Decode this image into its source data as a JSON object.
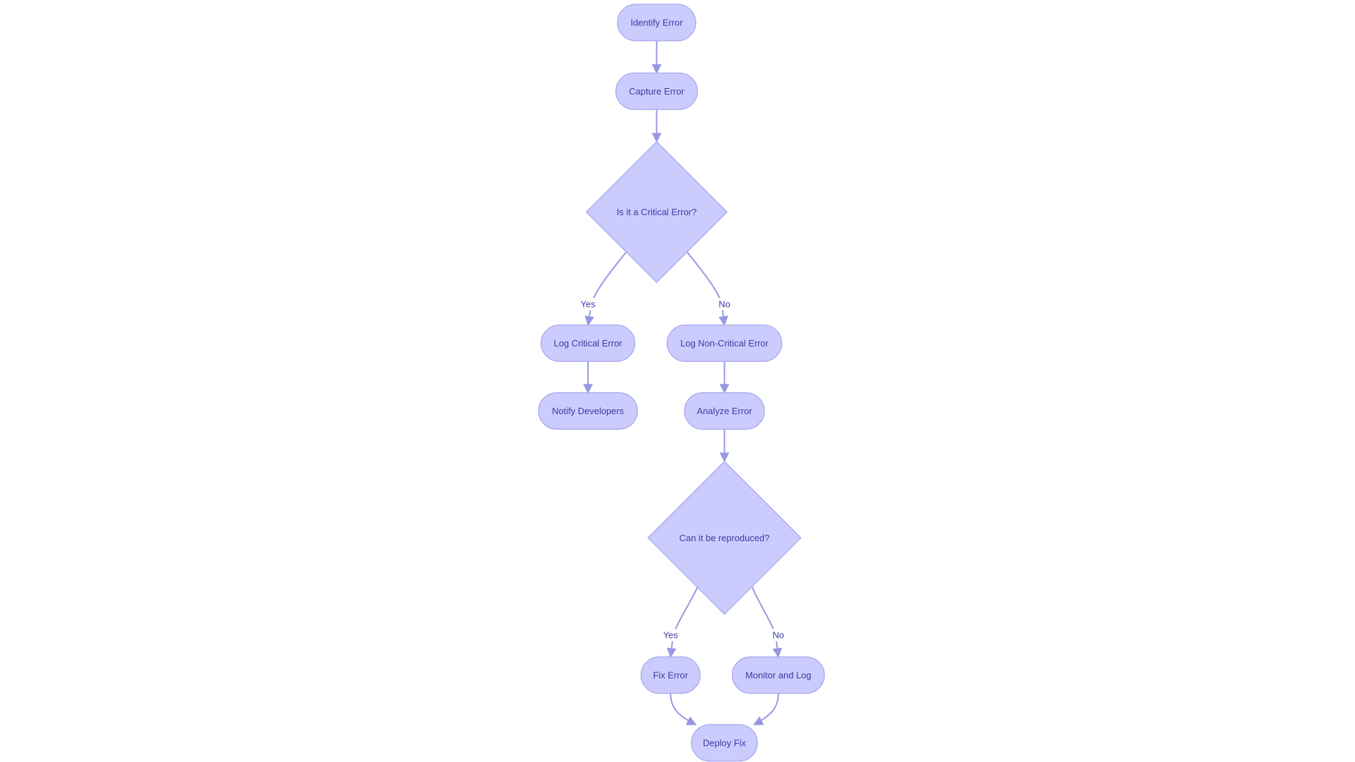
{
  "diagram": {
    "type": "flowchart",
    "direction": "top-down",
    "colors": {
      "node_fill": "#cbcbfd",
      "node_stroke": "#a6a6ef",
      "text": "#3b3ba6",
      "edge": "#9797e2",
      "background": "#ffffff"
    },
    "nodes": [
      {
        "id": "identify",
        "label": "Identify Error",
        "shape": "rounded"
      },
      {
        "id": "capture",
        "label": "Capture Error",
        "shape": "rounded"
      },
      {
        "id": "critical",
        "label": "Is it a Critical Error?",
        "shape": "diamond"
      },
      {
        "id": "logcrit",
        "label": "Log Critical Error",
        "shape": "rounded"
      },
      {
        "id": "lognon",
        "label": "Log Non-Critical Error",
        "shape": "rounded"
      },
      {
        "id": "notify",
        "label": "Notify Developers",
        "shape": "rounded"
      },
      {
        "id": "analyze",
        "label": "Analyze Error",
        "shape": "rounded"
      },
      {
        "id": "repro",
        "label": "Can it be reproduced?",
        "shape": "diamond"
      },
      {
        "id": "fix",
        "label": "Fix Error",
        "shape": "rounded"
      },
      {
        "id": "monitor",
        "label": "Monitor and Log",
        "shape": "rounded"
      },
      {
        "id": "deploy",
        "label": "Deploy Fix",
        "shape": "rounded"
      }
    ],
    "edges": [
      {
        "from": "identify",
        "to": "capture",
        "label": ""
      },
      {
        "from": "capture",
        "to": "critical",
        "label": ""
      },
      {
        "from": "critical",
        "to": "logcrit",
        "label": "Yes"
      },
      {
        "from": "critical",
        "to": "lognon",
        "label": "No"
      },
      {
        "from": "logcrit",
        "to": "notify",
        "label": ""
      },
      {
        "from": "lognon",
        "to": "analyze",
        "label": ""
      },
      {
        "from": "analyze",
        "to": "repro",
        "label": ""
      },
      {
        "from": "repro",
        "to": "fix",
        "label": "Yes"
      },
      {
        "from": "repro",
        "to": "monitor",
        "label": "No"
      },
      {
        "from": "fix",
        "to": "deploy",
        "label": ""
      },
      {
        "from": "monitor",
        "to": "deploy",
        "label": ""
      }
    ]
  }
}
